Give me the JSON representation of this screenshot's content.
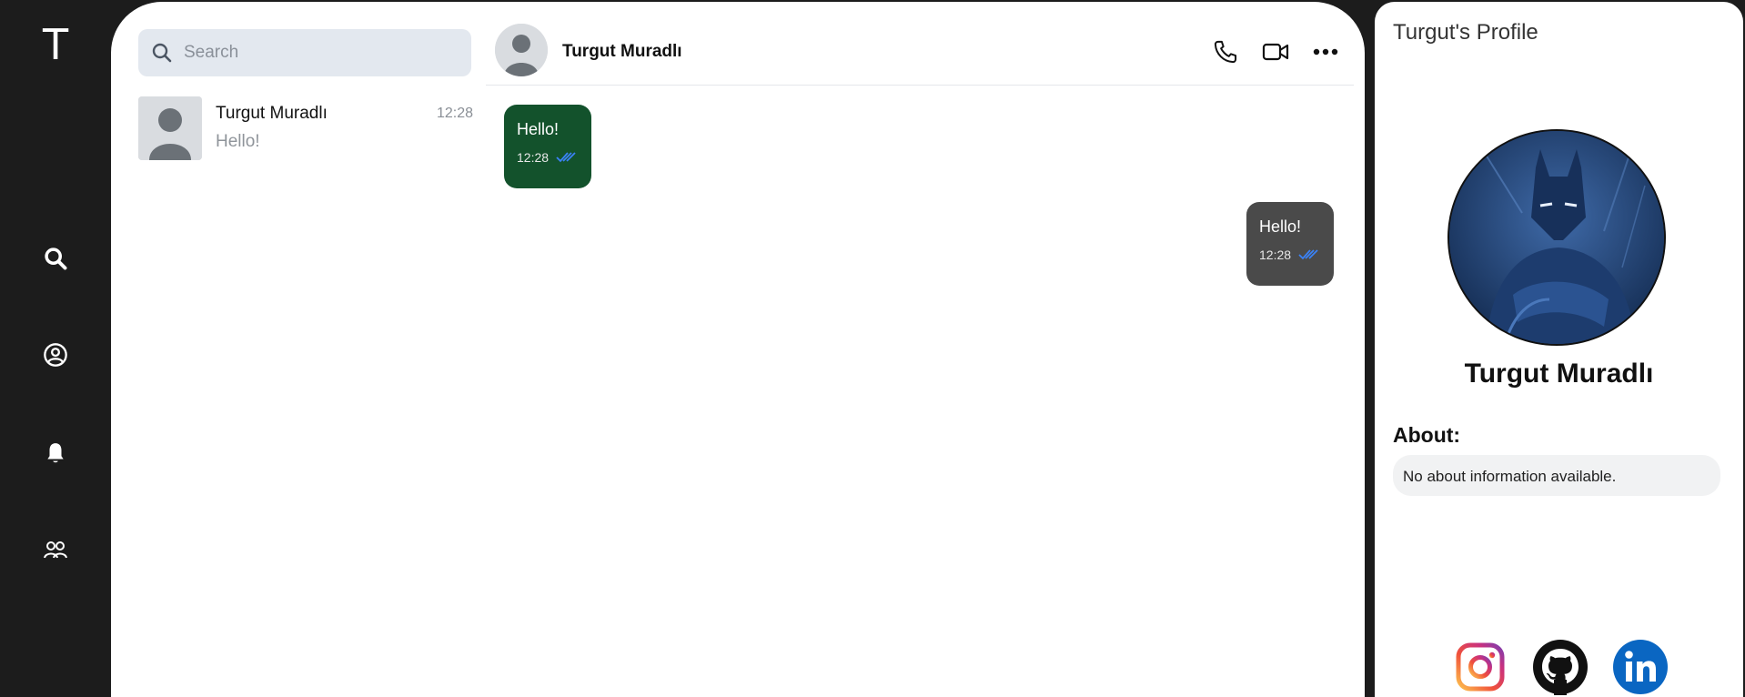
{
  "rail": {
    "logo": "T",
    "items": [
      {
        "icon": "search-icon"
      },
      {
        "icon": "user-circle-icon"
      },
      {
        "icon": "bell-icon"
      },
      {
        "icon": "users-icon"
      }
    ]
  },
  "search": {
    "placeholder": "Search",
    "icon": "search-icon"
  },
  "chat_list": [
    {
      "name": "Turgut Muradlı",
      "time": "12:28",
      "preview": "Hello!"
    }
  ],
  "conversation": {
    "name": "Turgut Muradlı",
    "actions": [
      "phone-icon",
      "video-icon",
      "more-icon"
    ],
    "messages": [
      {
        "direction": "incoming",
        "text": "Hello!",
        "time": "12:28",
        "color": "#13522c"
      },
      {
        "direction": "outgoing",
        "text": "Hello!",
        "time": "12:28",
        "color": "#4a4a4a"
      }
    ]
  },
  "profile": {
    "title": "Turgut's Profile",
    "name": "Turgut Muradlı",
    "about_label": "About:",
    "about_text": "No about information available.",
    "socials": [
      "instagram-icon",
      "github-icon",
      "linkedin-icon"
    ]
  },
  "colors": {
    "rail_bg": "#1c1c1c",
    "incoming_bubble": "#13522c",
    "outgoing_bubble": "#4a4a4a",
    "read_tick": "#3b82f6",
    "search_bg": "#e3e8ef",
    "linkedin": "#0a66c2"
  }
}
